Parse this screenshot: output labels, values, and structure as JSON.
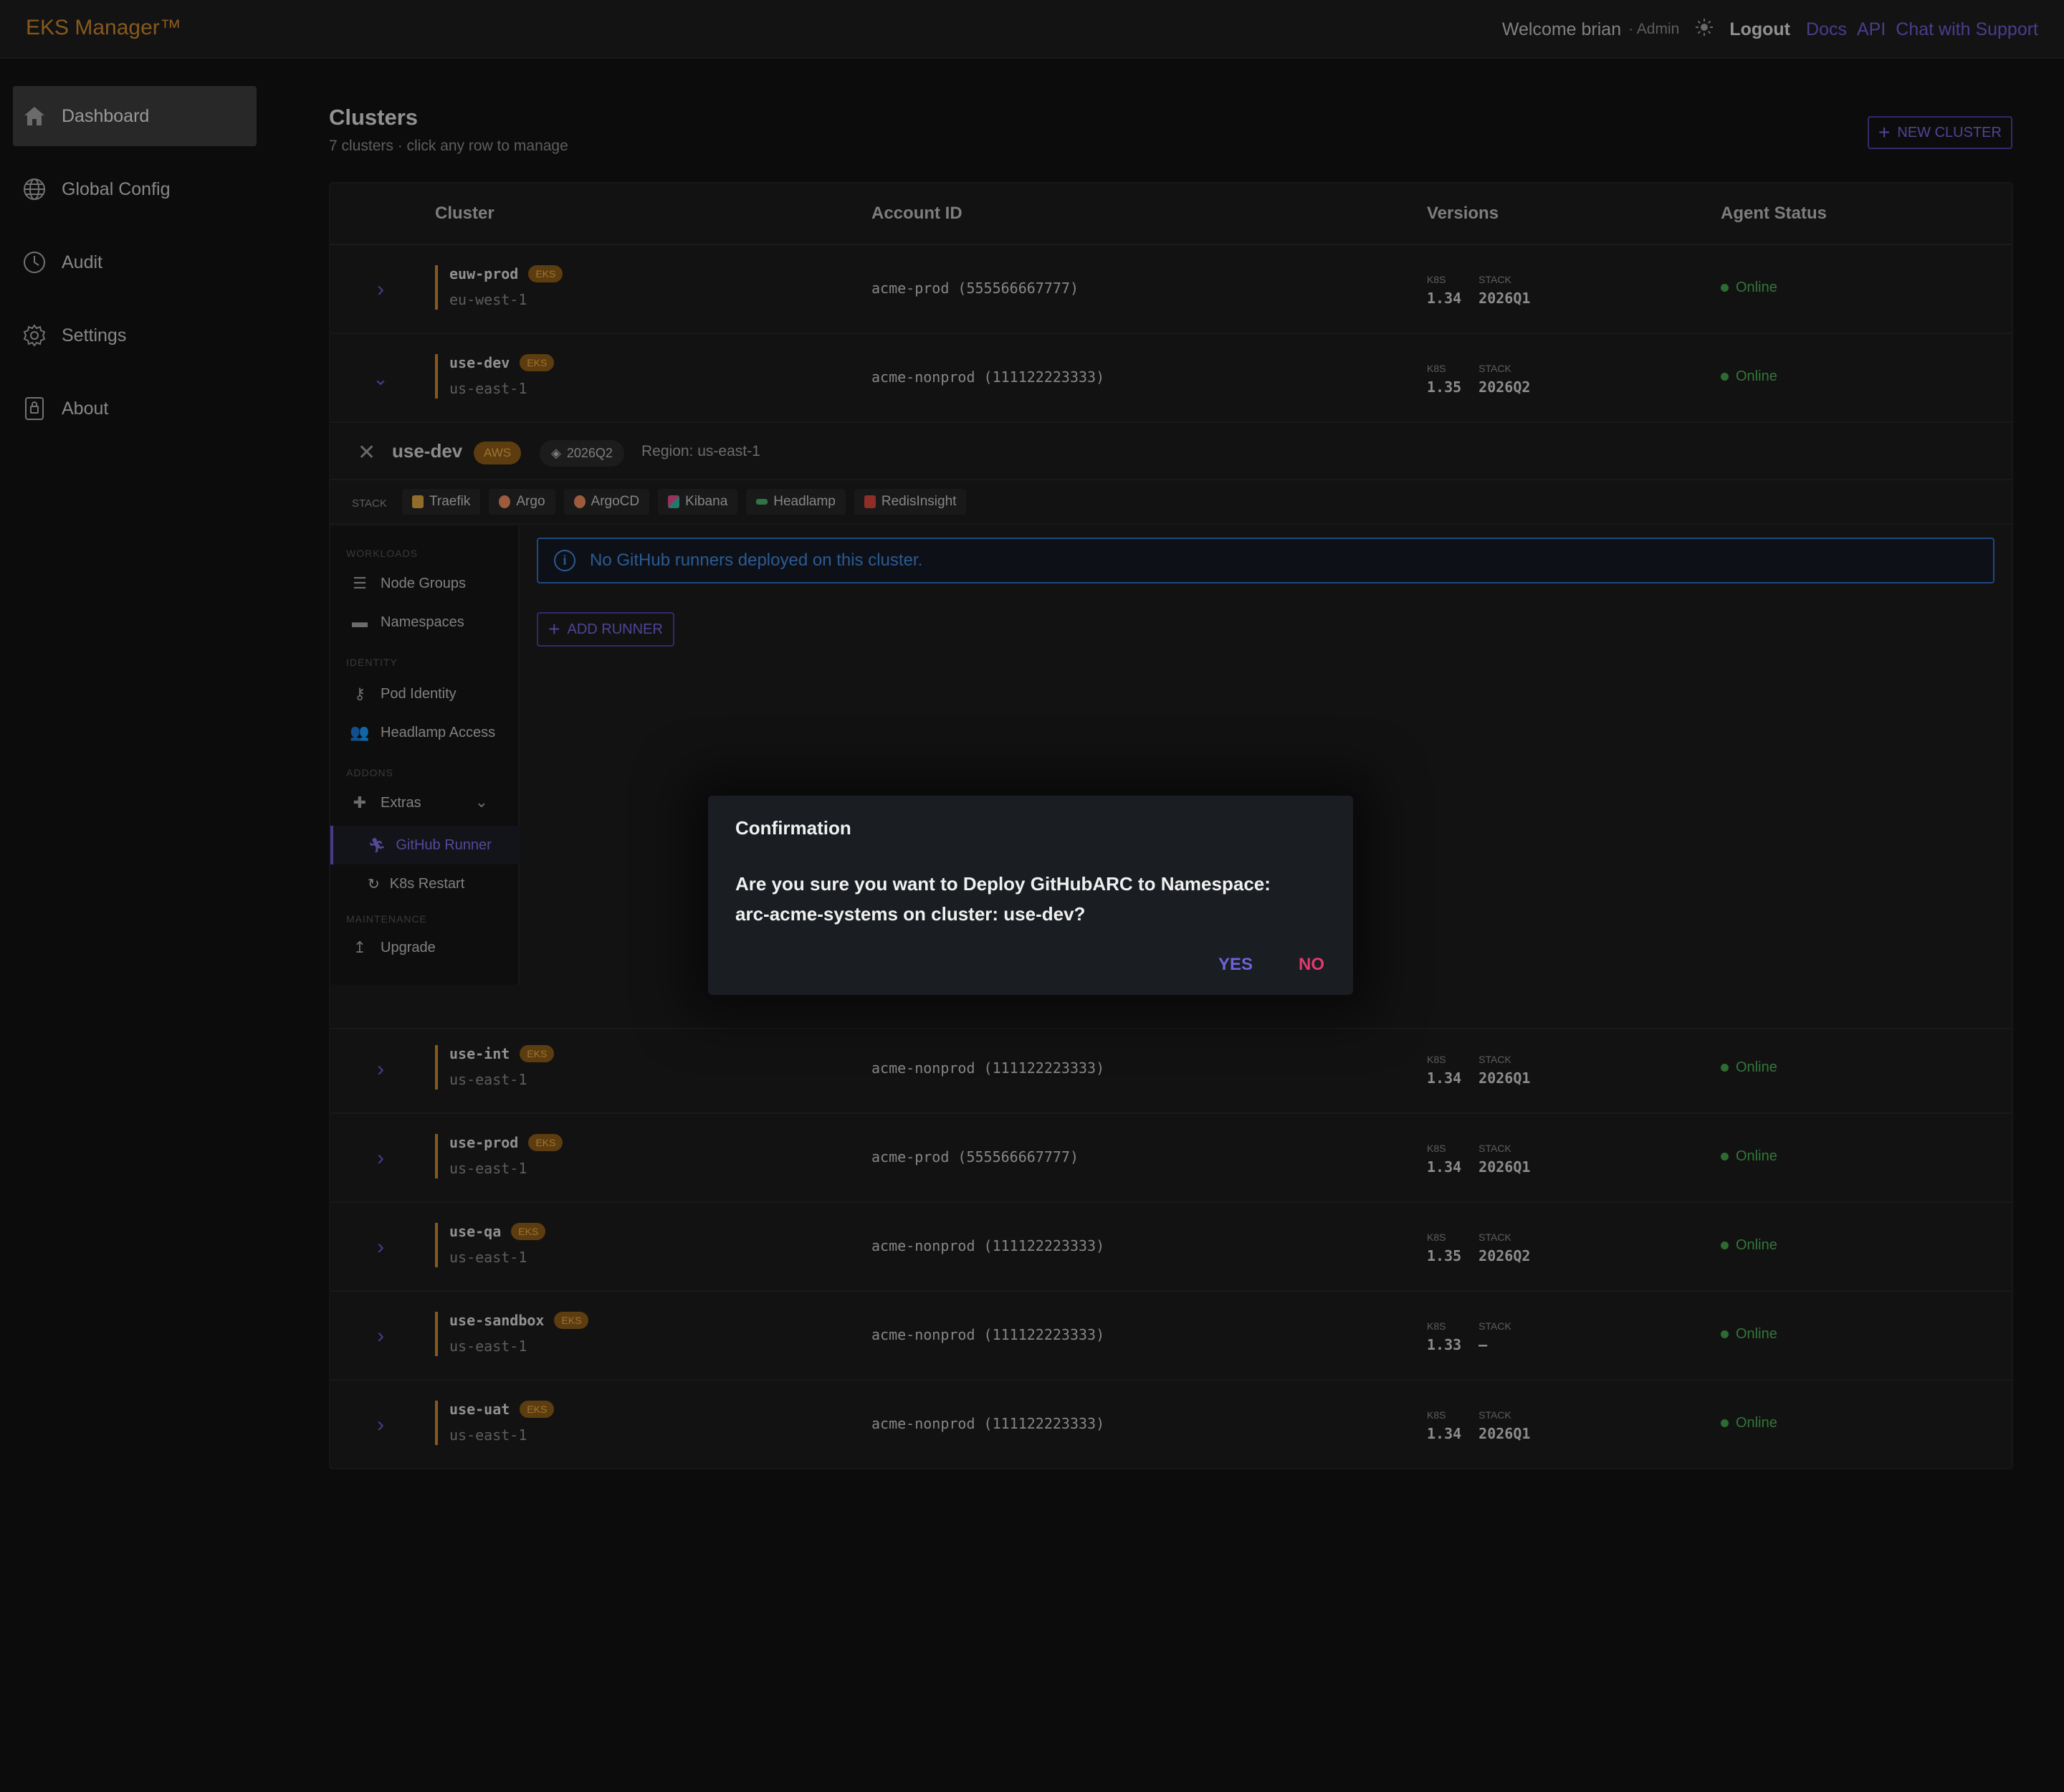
{
  "app": {
    "brand": "EKS Manager™"
  },
  "header": {
    "welcome": "Welcome brian",
    "role": "· Admin",
    "logout": "Logout",
    "links": [
      "Docs",
      "API",
      "Chat with Support"
    ]
  },
  "sidebar": {
    "items": [
      {
        "label": "Dashboard",
        "icon": "home-icon",
        "active": true
      },
      {
        "label": "Global Config",
        "icon": "globe-icon"
      },
      {
        "label": "Audit",
        "icon": "clock-icon"
      },
      {
        "label": "Settings",
        "icon": "gear-icon"
      },
      {
        "label": "About",
        "icon": "lock-icon"
      }
    ]
  },
  "main": {
    "title": "Clusters",
    "subtitle": "7 clusters · click any row to manage",
    "new_cluster": "NEW CLUSTER"
  },
  "table": {
    "columns": [
      "Cluster",
      "Account ID",
      "Versions",
      "Agent Status"
    ],
    "k8s_label": "K8S",
    "stack_label": "STACK",
    "rows": [
      {
        "name": "euw-prod",
        "badge": "EKS",
        "region": "eu-west-1",
        "account": "acme-prod (555566667777)",
        "k8s": "1.34",
        "stack": "2026Q1",
        "status": "Online"
      },
      {
        "name": "use-dev",
        "badge": "EKS",
        "region": "us-east-1",
        "account": "acme-nonprod (111122223333)",
        "k8s": "1.35",
        "stack": "2026Q2",
        "status": "Online",
        "expanded": true
      },
      {
        "name": "use-int",
        "badge": "EKS",
        "region": "us-east-1",
        "account": "acme-nonprod (111122223333)",
        "k8s": "1.34",
        "stack": "2026Q1",
        "status": "Online"
      },
      {
        "name": "use-prod",
        "badge": "EKS",
        "region": "us-east-1",
        "account": "acme-prod (555566667777)",
        "k8s": "1.34",
        "stack": "2026Q1",
        "status": "Online"
      },
      {
        "name": "use-qa",
        "badge": "EKS",
        "region": "us-east-1",
        "account": "acme-nonprod (111122223333)",
        "k8s": "1.35",
        "stack": "2026Q2",
        "status": "Online"
      },
      {
        "name": "use-sandbox",
        "badge": "EKS",
        "region": "us-east-1",
        "account": "acme-nonprod (111122223333)",
        "k8s": "1.33",
        "stack": "–",
        "status": "Online"
      },
      {
        "name": "use-uat",
        "badge": "EKS",
        "region": "us-east-1",
        "account": "acme-nonprod (111122223333)",
        "k8s": "1.34",
        "stack": "2026Q1",
        "status": "Online"
      }
    ]
  },
  "detail": {
    "title": "use-dev",
    "badge": "AWS",
    "stack_version": "2026Q2",
    "region": "Region: us-east-1",
    "stack_label": "STACK",
    "stack_items": [
      {
        "label": "Traefik",
        "color": "#d8a040"
      },
      {
        "label": "Argo",
        "color": "#e8865a"
      },
      {
        "label": "ArgoCD",
        "color": "#e8865a"
      },
      {
        "label": "Kibana",
        "color": "#e04a8a"
      },
      {
        "label": "Headlamp",
        "color": "#4aa86a"
      },
      {
        "label": "RedisInsight",
        "color": "#d0443a"
      }
    ],
    "side": {
      "workloads": "WORKLOADS",
      "node_groups": "Node Groups",
      "namespaces": "Namespaces",
      "identity": "IDENTITY",
      "pod_identity": "Pod Identity",
      "headlamp_access": "Headlamp Access",
      "addons": "ADDONS",
      "extras": "Extras",
      "github_runner": "GitHub Runner",
      "k8s_restart": "K8s Restart",
      "maintenance": "MAINTENANCE",
      "upgrade": "Upgrade"
    },
    "info": "No GitHub runners deployed on this cluster.",
    "add_runner": "ADD RUNNER"
  },
  "dialog": {
    "title": "Confirmation",
    "body": "Are you sure you want to Deploy GitHubARC to Namespace: arc-acme-systems on cluster: use-dev?",
    "yes": "YES",
    "no": "NO"
  },
  "colors": {
    "accent": "#6658cc",
    "brand": "#c7832a",
    "online": "#43a047",
    "info": "#3f86d8",
    "danger": "#e0396f"
  }
}
